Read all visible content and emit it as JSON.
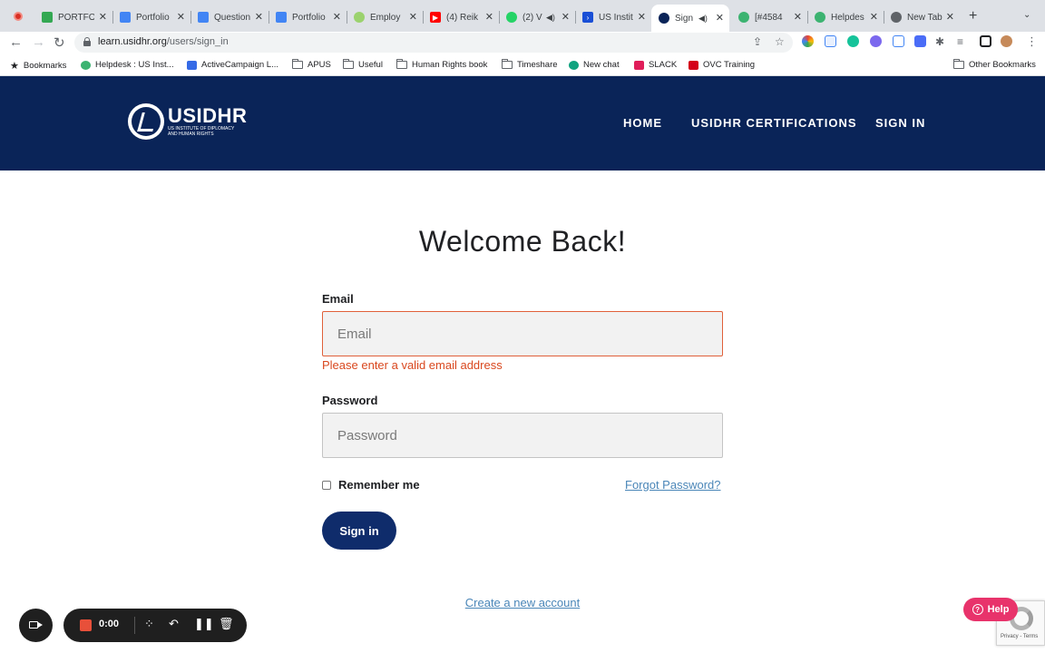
{
  "browser": {
    "tabs": [
      {
        "title": "PORTFO",
        "color": "#34a853"
      },
      {
        "title": "Portfolio",
        "color": "#4285f4"
      },
      {
        "title": "Question",
        "color": "#4285f4"
      },
      {
        "title": "Portfolio",
        "color": "#4285f4"
      },
      {
        "title": "Employ",
        "color": "#9bd26e"
      },
      {
        "title": "(4) Reik",
        "color": "#ff0000"
      },
      {
        "title": "(2) V",
        "color": "#25d366"
      },
      {
        "title": "US Instit",
        "color": "#1a4fd6"
      },
      {
        "title": "Sign",
        "color": "#0a2458",
        "active": true
      },
      {
        "title": "[#4584",
        "color": "#3cb371"
      },
      {
        "title": "Helpdes",
        "color": "#3cb371"
      },
      {
        "title": "New Tab",
        "color": "#5f6368"
      }
    ],
    "url_host": "learn.usidhr.org",
    "url_path": "/users/sign_in",
    "bookmarks": [
      {
        "label": "Bookmarks",
        "type": "star"
      },
      {
        "label": "Helpdesk : US Inst...",
        "type": "site",
        "color": "#3cb371"
      },
      {
        "label": "ActiveCampaign L...",
        "type": "site",
        "color": "#356ae6"
      },
      {
        "label": "APUS",
        "type": "folder"
      },
      {
        "label": "Useful",
        "type": "folder"
      },
      {
        "label": "Human Rights book",
        "type": "folder"
      },
      {
        "label": "Timeshare",
        "type": "folder"
      },
      {
        "label": "New chat",
        "type": "site",
        "color": "#10a37f"
      },
      {
        "label": "SLACK",
        "type": "site",
        "color": "#e01e5a"
      },
      {
        "label": "OVC Training",
        "type": "site",
        "color": "#d4001a"
      }
    ],
    "other_bookmarks": "Other Bookmarks"
  },
  "site": {
    "logo_name": "USIDHR",
    "logo_sub": "US INSTITUTE OF DIPLOMACY AND HUMAN RIGHTS",
    "nav": [
      "HOME",
      "USIDHR CERTIFICATIONS",
      "SIGN IN"
    ]
  },
  "form": {
    "heading": "Welcome Back!",
    "email_label": "Email",
    "email_placeholder": "Email",
    "email_error": "Please enter a valid email address",
    "password_label": "Password",
    "password_placeholder": "Password",
    "remember_label": "Remember me",
    "forgot_link": "Forgot Password?",
    "submit_label": "Sign in",
    "create_link": "Create a new account"
  },
  "recorder": {
    "timer": "0:00"
  },
  "help": {
    "label": "Help",
    "recaptcha_text": "Privacy - Terms"
  },
  "colors": {
    "header_bg": "#0a2458",
    "button_bg": "#0f2c6b",
    "error": "#d9481f",
    "link": "#4a86b8",
    "help": "#e8336b"
  }
}
